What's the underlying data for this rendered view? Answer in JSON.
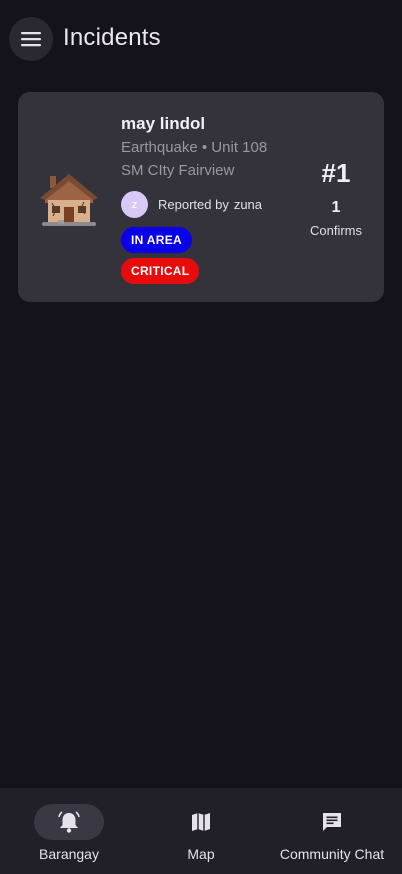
{
  "app_bar": {
    "title": "Incidents",
    "menu_icon": "hamburger-menu-icon"
  },
  "incident": {
    "icon": "damaged-house-icon",
    "title": "may lindol",
    "subtitle": "Earthquake • Unit 108",
    "location": "SM CIty Fairview",
    "reporter_avatar": "z",
    "reported_by_label": "Reported by",
    "reporter_name": "zuna",
    "badges": [
      {
        "label": "IN AREA",
        "color": "#0a00ea"
      },
      {
        "label": "CRITICAL",
        "color": "#e80b0b"
      }
    ],
    "rank": "#1",
    "confirm_count": "1",
    "confirm_label": "Confirms"
  },
  "bottom_nav": {
    "items": [
      {
        "label": "Barangay",
        "icon": "bell-alert-icon",
        "active": true
      },
      {
        "label": "Map",
        "icon": "map-icon",
        "active": false
      },
      {
        "label": "Community Chat",
        "icon": "chat-icon",
        "active": false
      }
    ]
  }
}
